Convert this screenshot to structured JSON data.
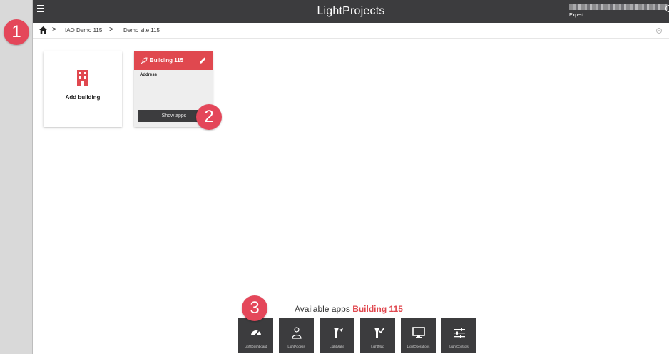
{
  "header": {
    "app_title": "LightProjects",
    "user_role": "Expert"
  },
  "breadcrumb": {
    "home_icon": "home-icon",
    "separator": ">",
    "items": [
      "IAO Demo 115",
      "Demo site 115"
    ]
  },
  "cards": {
    "add_building": {
      "label": "Add building",
      "icon": "building-icon"
    },
    "building": {
      "title": "Building 115",
      "address_label": "Address",
      "show_apps_label": "Show apps"
    }
  },
  "apps_panel": {
    "heading_prefix": "Available apps",
    "heading_highlight": "Building 115",
    "apps": [
      {
        "label": "LightDashboard",
        "icon": "speedometer-icon"
      },
      {
        "label": "LightAccess",
        "icon": "person-outline-icon"
      },
      {
        "label": "LightMake",
        "icon": "lamp-icon"
      },
      {
        "label": "LightMap",
        "icon": "lamp-check-icon"
      },
      {
        "label": "LightOperations",
        "icon": "monitor-icon"
      },
      {
        "label": "LightControls",
        "icon": "sliders-icon"
      }
    ]
  },
  "callouts": [
    "1",
    "2",
    "3"
  ],
  "colors": {
    "accent": "#e0484f",
    "topbar": "#3c3c3e",
    "callout": "#e4475a"
  }
}
